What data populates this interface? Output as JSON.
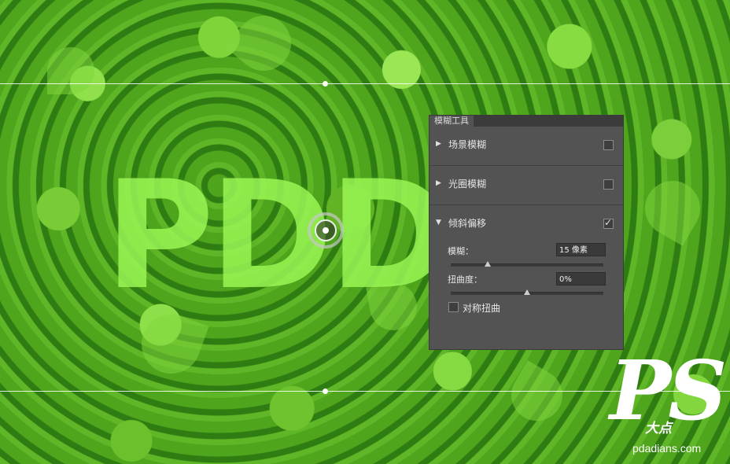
{
  "canvas": {
    "overlay_text": "PDD",
    "colors": {
      "text": "#99f554",
      "background": "#3b8f17"
    }
  },
  "panel": {
    "title": "模糊工具",
    "sections": [
      {
        "label": "场景模糊",
        "expanded": false,
        "checked": false
      },
      {
        "label": "光圈模糊",
        "expanded": false,
        "checked": false
      },
      {
        "label": "倾斜偏移",
        "expanded": true,
        "checked": true
      }
    ],
    "tilt_shift": {
      "blur_label": "模糊：",
      "blur_value": "15 像素",
      "blur_slider": 0.24,
      "distortion_label": "扭曲度：",
      "distortion_value": "0%",
      "distortion_slider": 0.5,
      "symmetric_label": "对称扭曲",
      "symmetric_checked": false
    }
  },
  "watermark": {
    "ps": "PS",
    "cn": "大点",
    "url": "pdadians.com"
  }
}
